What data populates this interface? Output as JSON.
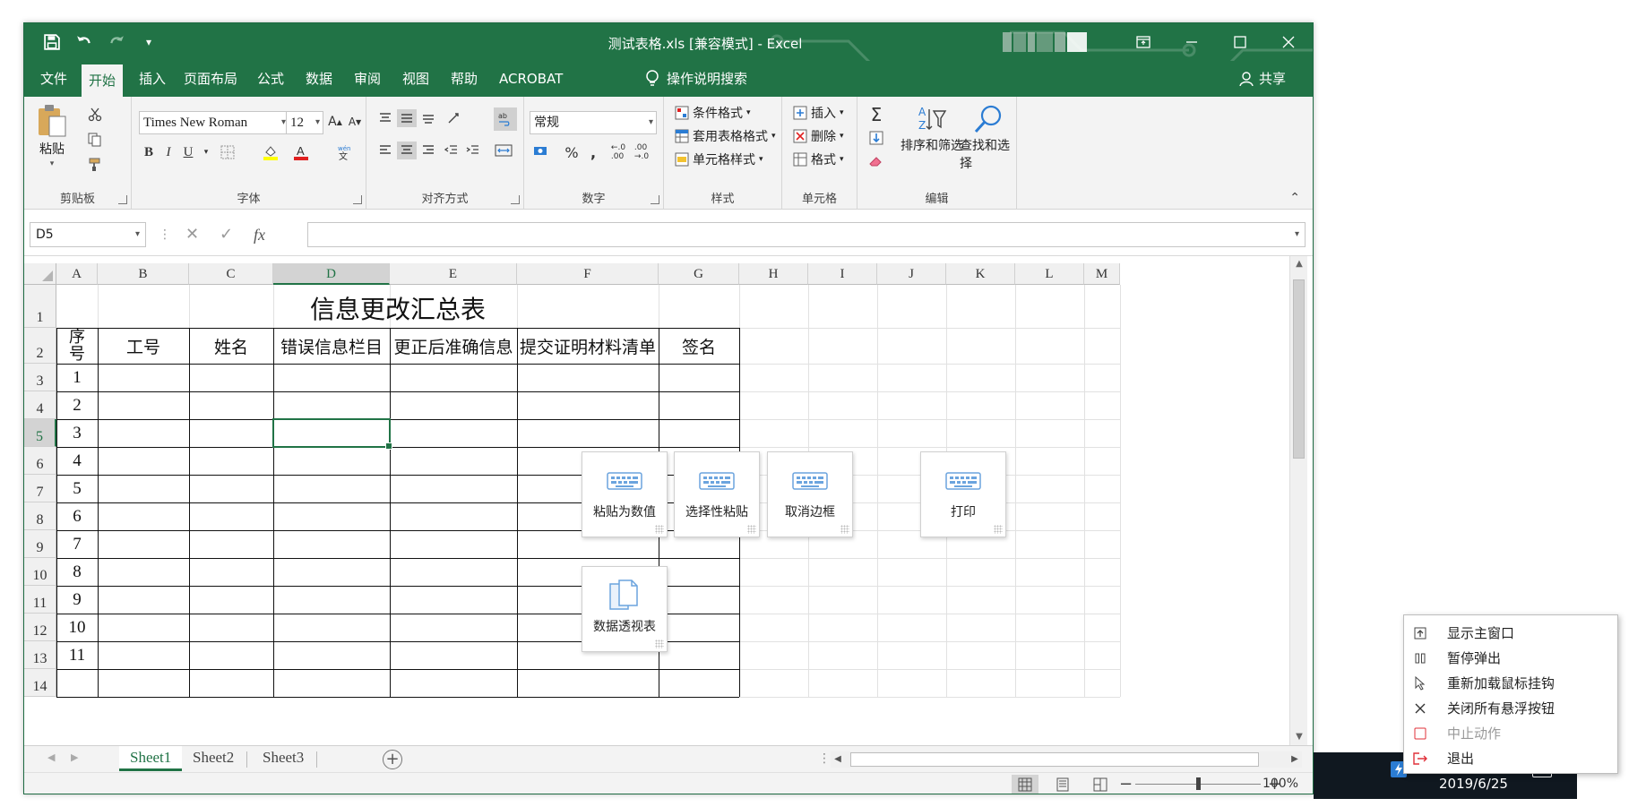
{
  "window": {
    "title": "测试表格.xls  [兼容模式]  -  Excel",
    "controls": [
      "ribbon-display-icon",
      "minimize-icon",
      "maximize-icon",
      "close-icon"
    ]
  },
  "qat": {
    "items": [
      "save-icon",
      "undo-icon",
      "redo-icon",
      "customize-icon"
    ]
  },
  "tabs": {
    "items": [
      "文件",
      "开始",
      "插入",
      "页面布局",
      "公式",
      "数据",
      "审阅",
      "视图",
      "帮助",
      "ACROBAT"
    ],
    "active": "开始",
    "tellme": "操作说明搜索",
    "share": "共享"
  },
  "ribbon": {
    "clipboard": {
      "paste": "粘贴",
      "label": "剪贴板"
    },
    "font": {
      "name": "Times New Roman",
      "size": "12",
      "bold": "B",
      "italic": "I",
      "underline": "U",
      "label": "字体"
    },
    "alignment": {
      "label": "对齐方式"
    },
    "number": {
      "format": "常规",
      "percent": "%",
      "comma": ",",
      "label": "数字"
    },
    "styles": {
      "conditional": "条件格式",
      "table": "套用表格格式",
      "cell": "单元格样式",
      "label": "样式"
    },
    "cells": {
      "insert": "插入",
      "delete": "删除",
      "format": "格式",
      "label": "单元格"
    },
    "editing": {
      "sort": "排序和筛选",
      "find": "查找和选择",
      "label": "编辑"
    }
  },
  "formula_bar": {
    "name_box": "D5",
    "fx": "fx",
    "content": ""
  },
  "grid": {
    "columns": [
      "A",
      "B",
      "C",
      "D",
      "E",
      "F",
      "G",
      "H",
      "I",
      "J",
      "K",
      "L",
      "M"
    ],
    "rows": [
      "1",
      "2",
      "3",
      "4",
      "5",
      "6",
      "7",
      "8",
      "9",
      "10",
      "11",
      "12",
      "13",
      "14"
    ],
    "selected_cell": "D5"
  },
  "table": {
    "title": "信息更改汇总表",
    "headers": [
      "序号",
      "工号",
      "姓名",
      "错误信息栏目",
      "更正后准确信息",
      "提交证明材料清单",
      "签名"
    ],
    "serials": [
      "1",
      "2",
      "3",
      "4",
      "5",
      "6",
      "7",
      "8",
      "9",
      "10",
      "11"
    ]
  },
  "sheets": {
    "items": [
      "Sheet1",
      "Sheet2",
      "Sheet3"
    ],
    "active": "Sheet1"
  },
  "status": {
    "zoom": "100%",
    "zoom_fraction": 0.5
  },
  "floating_buttons": [
    {
      "label": "粘贴为数值",
      "icon": "keyboard-icon"
    },
    {
      "label": "选择性粘贴",
      "icon": "keyboard-icon"
    },
    {
      "label": "取消边框",
      "icon": "keyboard-icon"
    },
    {
      "label": "打印",
      "icon": "keyboard-icon"
    },
    {
      "label": "数据透视表",
      "icon": "documents-icon"
    }
  ],
  "context_menu": {
    "items": [
      {
        "label": "显示主窗口",
        "icon": "window-up-icon",
        "disabled": false
      },
      {
        "label": "暂停弹出",
        "icon": "pause-icon",
        "disabled": false
      },
      {
        "label": "重新加载鼠标挂钩",
        "icon": "cursor-icon",
        "disabled": false
      },
      {
        "label": "关闭所有悬浮按钮",
        "icon": "close-icon",
        "disabled": false
      },
      {
        "label": "中止动作",
        "icon": "stop-icon",
        "disabled": true
      },
      {
        "label": "退出",
        "icon": "exit-icon",
        "disabled": false
      }
    ]
  },
  "taskbar": {
    "date": "2019/6/25"
  },
  "colors": {
    "excel_green": "#217346",
    "grid_line": "#e1e1e1",
    "accent_blue": "#2b7cd3",
    "exit_red": "#e0303a"
  }
}
